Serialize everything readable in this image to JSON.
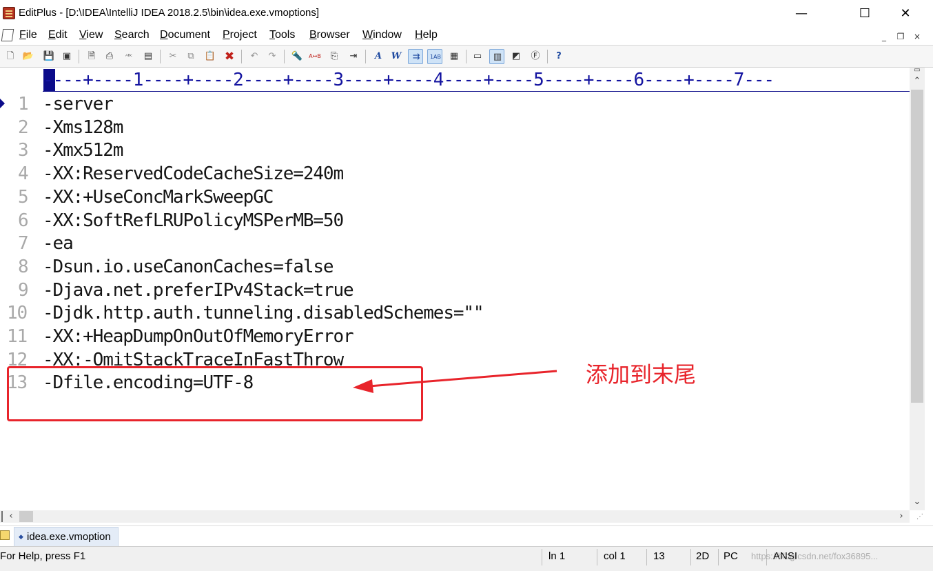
{
  "window": {
    "title": "EditPlus - [D:\\IDEA\\IntelliJ IDEA 2018.2.5\\bin\\idea.exe.vmoptions]",
    "minimize": "—",
    "maximize": "☐",
    "close": "✕"
  },
  "menu": {
    "items": [
      "File",
      "Edit",
      "View",
      "Search",
      "Document",
      "Project",
      "Tools",
      "Browser",
      "Window",
      "Help"
    ],
    "mdi": {
      "minimize": "_",
      "restore": "❐",
      "close": "×"
    }
  },
  "toolbar": {
    "icons": [
      {
        "name": "new-file-icon",
        "glyph": "🗋"
      },
      {
        "name": "open-folder-icon",
        "glyph": "📂"
      },
      {
        "name": "save-icon",
        "glyph": "💾"
      },
      {
        "name": "save-all-icon",
        "glyph": "▣"
      },
      {
        "name": "print-preview-icon",
        "glyph": "🗎"
      },
      {
        "name": "print-icon",
        "glyph": "⎙"
      },
      {
        "name": "spell-check-icon",
        "glyph": "ᴬᴮᶜ"
      },
      {
        "name": "clipboard-icon",
        "glyph": "▤"
      },
      {
        "name": "cut-icon",
        "glyph": "✂"
      },
      {
        "name": "copy-icon",
        "glyph": "⧉"
      },
      {
        "name": "paste-icon",
        "glyph": "📋"
      },
      {
        "name": "delete-icon",
        "glyph": "✖"
      },
      {
        "name": "undo-icon",
        "glyph": "↶"
      },
      {
        "name": "redo-icon",
        "glyph": "↷"
      },
      {
        "name": "find-icon",
        "glyph": "🔦"
      },
      {
        "name": "replace-icon",
        "glyph": "A↔B"
      },
      {
        "name": "find-in-files-icon",
        "glyph": "⎘"
      },
      {
        "name": "goto-icon",
        "glyph": "⇥"
      },
      {
        "name": "font-icon",
        "glyph": "A"
      },
      {
        "name": "word-wrap-icon",
        "glyph": "W"
      },
      {
        "name": "indent-icon",
        "glyph": "⇉"
      },
      {
        "name": "line-number-icon",
        "glyph": "1AB"
      },
      {
        "name": "ruler-icon",
        "glyph": "▦"
      },
      {
        "name": "panel-icon",
        "glyph": "▭"
      },
      {
        "name": "cliptext-icon",
        "glyph": "▥"
      },
      {
        "name": "browser-icon",
        "glyph": "◩"
      },
      {
        "name": "function-list-icon",
        "glyph": "Ⓕ"
      },
      {
        "name": "help-icon",
        "glyph": "?"
      }
    ]
  },
  "editor": {
    "ruler": "----+----1----+----2----+----3----+----4----+----5----+----6----+----7---",
    "lines": [
      {
        "num": "1",
        "text": "-server"
      },
      {
        "num": "2",
        "text": "-Xms128m"
      },
      {
        "num": "3",
        "text": "-Xmx512m"
      },
      {
        "num": "4",
        "text": "-XX:ReservedCodeCacheSize=240m"
      },
      {
        "num": "5",
        "text": "-XX:+UseConcMarkSweepGC"
      },
      {
        "num": "6",
        "text": "-XX:SoftRefLRUPolicyMSPerMB=50"
      },
      {
        "num": "7",
        "text": "-ea"
      },
      {
        "num": "8",
        "text": "-Dsun.io.useCanonCaches=false"
      },
      {
        "num": "9",
        "text": "-Djava.net.preferIPv4Stack=true"
      },
      {
        "num": "10",
        "text": "-Djdk.http.auth.tunneling.disabledSchemes=\"\""
      },
      {
        "num": "11",
        "text": "-XX:+HeapDumpOnOutOfMemoryError"
      },
      {
        "num": "12",
        "text": "-XX:-OmitStackTraceInFastThrow"
      },
      {
        "num": "13",
        "text": "-Dfile.encoding=UTF-8"
      }
    ],
    "annotation": "添加到末尾"
  },
  "tabs": {
    "active": "idea.exe.vmoption"
  },
  "status": {
    "help": "For Help, press F1",
    "ln": "ln 1",
    "col": "col 1",
    "lines": "13",
    "mode": "2D",
    "format": "PC",
    "encoding": "ANSI",
    "watermark": "https://blog.csdn.net/fox36895..."
  },
  "colors": {
    "accent_red": "#e8242b",
    "ruler_blue": "#1414a0",
    "line_number_gray": "#a9a9a9"
  }
}
